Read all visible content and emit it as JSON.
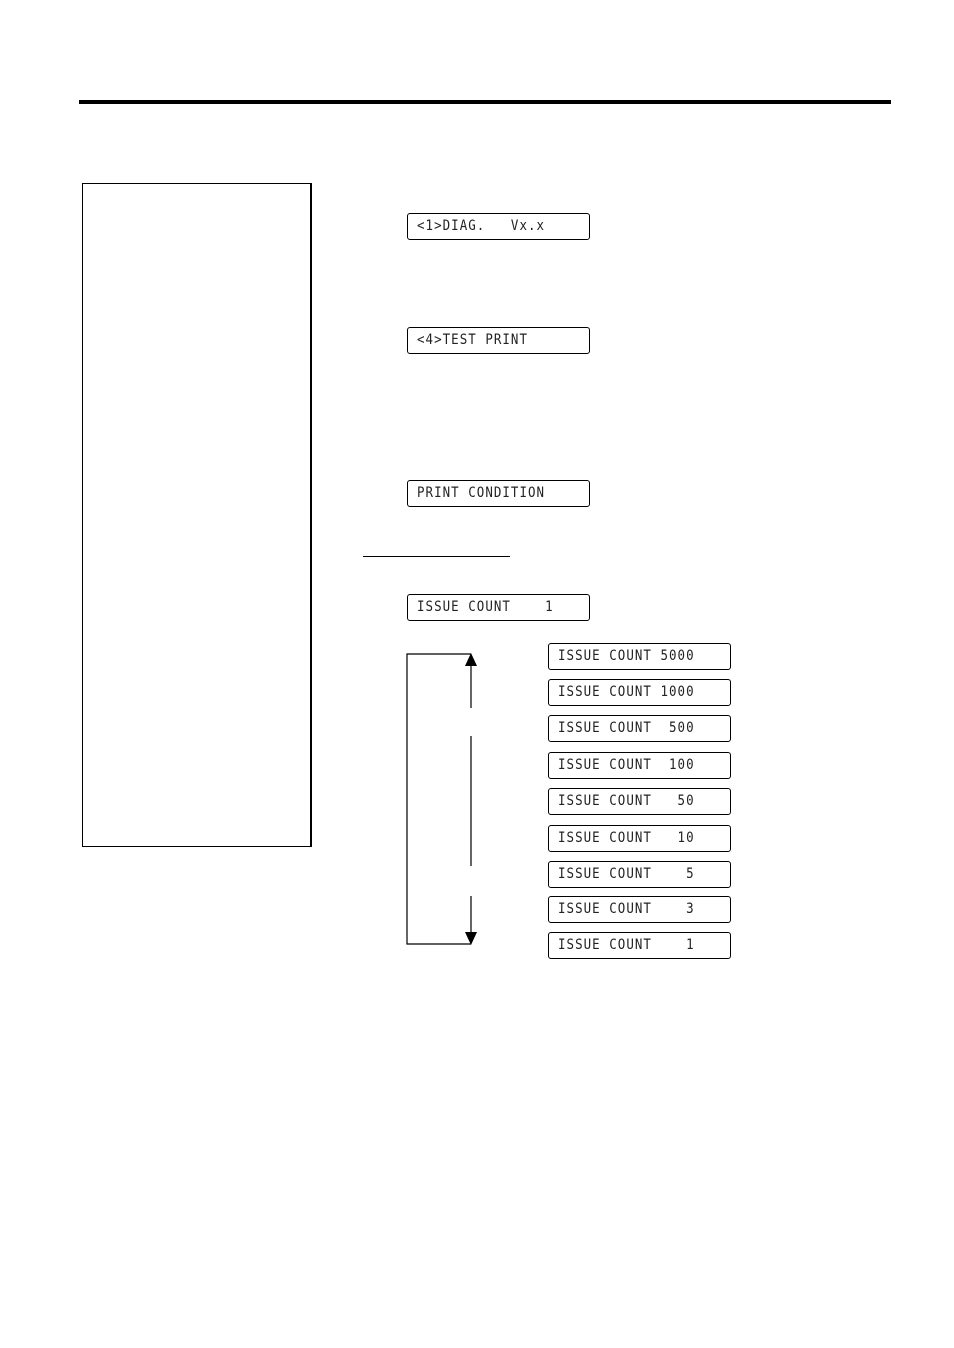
{
  "header": {},
  "main_displays": [
    {
      "text": "<1>DIAG.   Vx.x"
    },
    {
      "text": "<4>TEST PRINT"
    },
    {
      "text": "PRINT CONDITION"
    },
    {
      "text": "ISSUE COUNT    1"
    }
  ],
  "issue_count_options": [
    {
      "text": "ISSUE COUNT 5000"
    },
    {
      "text": "ISSUE COUNT 1000"
    },
    {
      "text": "ISSUE COUNT  500"
    },
    {
      "text": "ISSUE COUNT  100"
    },
    {
      "text": "ISSUE COUNT   50"
    },
    {
      "text": "ISSUE COUNT   10"
    },
    {
      "text": "ISSUE COUNT    5"
    },
    {
      "text": "ISSUE COUNT    3"
    },
    {
      "text": "ISSUE COUNT    1"
    }
  ]
}
